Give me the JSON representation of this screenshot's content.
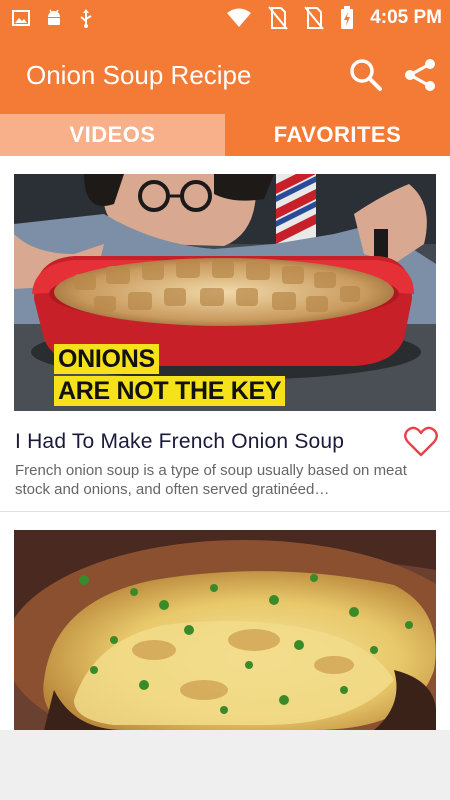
{
  "status_bar": {
    "time": "4:05 PM",
    "left_icons": [
      "image-icon",
      "android-icon",
      "usb-icon"
    ],
    "right_icons": [
      "wifi-icon",
      "no-sim-icon",
      "no-sim-icon",
      "battery-charging-icon"
    ]
  },
  "app_bar": {
    "title": "Onion Soup Recipe",
    "actions": [
      "search-icon",
      "share-icon"
    ]
  },
  "tabs": [
    {
      "label": "VIDEOS",
      "selected": false
    },
    {
      "label": "FAVORITES",
      "selected": true
    }
  ],
  "videos": [
    {
      "thumbnail_caption": [
        "ONIONS",
        "ARE NOT THE KEY"
      ],
      "title": "I Had To Make French Onion Soup",
      "description": "French onion soup  is a type of soup usually based on meat stock and onions, and often served gratinéed…",
      "favorite_icon": "heart-outline-icon"
    },
    {
      "thumbnail_caption": [],
      "title": "",
      "description": ""
    }
  ],
  "colors": {
    "primary": "#f47b36",
    "tab_inactive": "#f7b089",
    "caption_highlight": "#f5e21a",
    "favorite_red": "#e8424a"
  }
}
